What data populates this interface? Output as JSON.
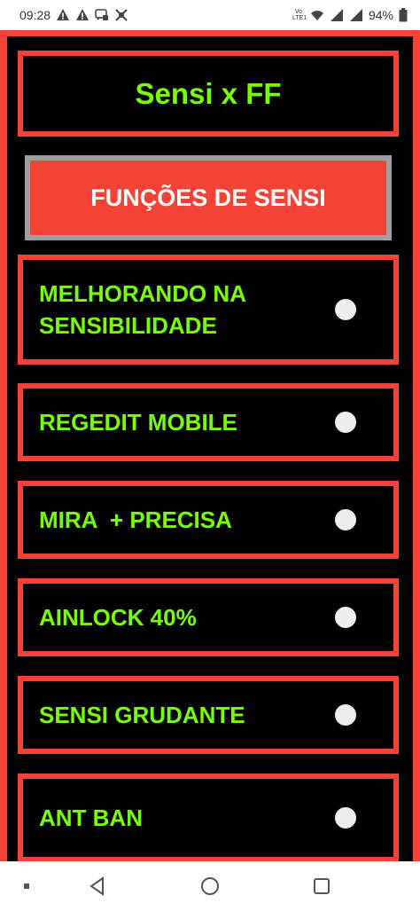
{
  "status_bar": {
    "time": "09:28",
    "volte_top": "Vo",
    "volte_bottom": "LTE1",
    "battery": "94%"
  },
  "app": {
    "title": "Sensi x FF",
    "header_button": "FUNÇÕES DE SENSI",
    "options": [
      {
        "label": "MELHORANDO NA SENSIBILIDADE"
      },
      {
        "label": "REGEDIT MOBILE"
      },
      {
        "label": "MIRA  + PRECISA"
      },
      {
        "label": "AINLOCK 40%"
      },
      {
        "label": "SENSI GRUDANTE"
      },
      {
        "label": "ANT BAN"
      }
    ]
  },
  "colors": {
    "accent_red": "#f44336",
    "text_green": "#76ff03",
    "background": "#000000",
    "header_border_gray": "#9e9e9e"
  },
  "icons": {
    "status_left": [
      "warning-icon",
      "warning-icon",
      "messenger-icon",
      "app-icon"
    ],
    "status_right": [
      "wifi-icon",
      "signal-icon",
      "signal-icon",
      "battery-icon"
    ],
    "nav": [
      "recent-dot-icon",
      "back-icon",
      "home-icon",
      "overview-icon"
    ]
  }
}
